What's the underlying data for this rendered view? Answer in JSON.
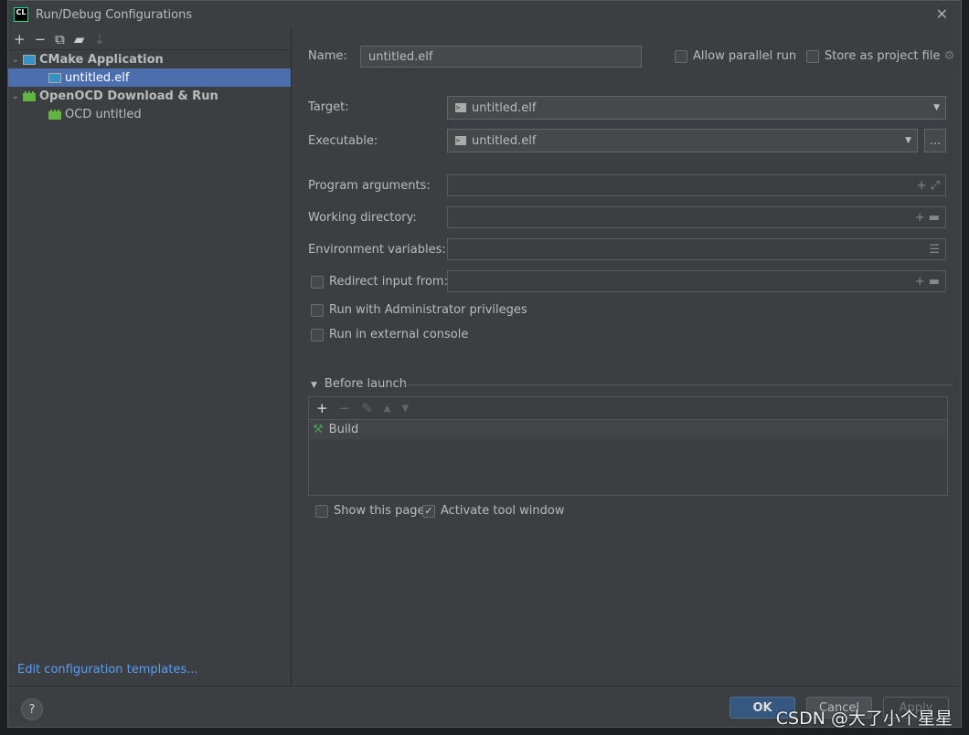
{
  "window": {
    "title": "Run/Debug Configurations",
    "logo": "CL"
  },
  "toolbar": {
    "icons": [
      "plus-icon",
      "minus-icon",
      "copy-icon",
      "folder-add-icon",
      "sort-icon"
    ]
  },
  "tree": [
    {
      "label": "CMake Application",
      "type": "group"
    },
    {
      "label": "untitled.elf",
      "type": "child",
      "selected": true
    },
    {
      "label": "OpenOCD Download & Run",
      "type": "group"
    },
    {
      "label": "OCD untitled",
      "type": "child"
    }
  ],
  "edit_templates": "Edit configuration templates...",
  "form": {
    "name_label": "Name:",
    "name_value": "untitled.elf",
    "allow_parallel": "Allow parallel run",
    "store_project": "Store as project file",
    "target_label": "Target:",
    "target_value": "untitled.elf",
    "exec_label": "Executable:",
    "exec_value": "untitled.elf",
    "browse": "...",
    "args_label": "Program arguments:",
    "workdir_label": "Working directory:",
    "env_label": "Environment variables:",
    "redirect_label": "Redirect input from:",
    "admin_label": "Run with Administrator privileges",
    "external_label": "Run in external console"
  },
  "before_launch": {
    "title": "Before launch",
    "items": [
      "Build"
    ],
    "show_page": "Show this page",
    "activate_tool": "Activate tool window",
    "activate_checked": true
  },
  "buttons": {
    "ok": "OK",
    "cancel": "Cancel",
    "apply": "Apply",
    "help": "?"
  },
  "watermark": "CSDN @大了小个星星",
  "colors": {
    "selection": "#4b6eaf",
    "link": "#589df6",
    "ok": "#365880"
  }
}
